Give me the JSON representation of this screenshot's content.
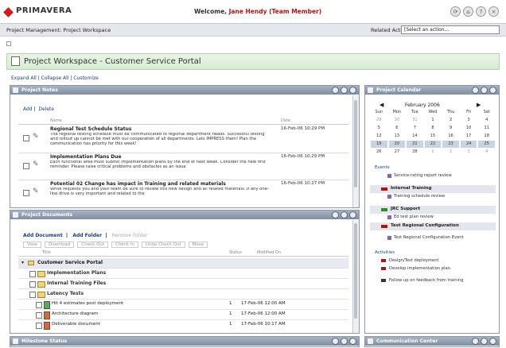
{
  "app": {
    "brand": "PRIMAVERA",
    "welcome_prefix": "Welcome,",
    "welcome_user": "Jane Hendy (Team Member)",
    "breadcrumb": "Project Management: Project Workspace",
    "related_actions_label": "Related Actions",
    "related_actions_value": "[Select an action..."
  },
  "page": {
    "title": "Project Workspace - Customer Service Portal",
    "expand_all": "Expand All",
    "collapse_all": "Collapse All",
    "customize": "Customize"
  },
  "project_notes": {
    "title": "Project Notes",
    "add": "Add",
    "delete": "Delete",
    "col_name": "Name",
    "col_date": "Date",
    "notes": [
      {
        "title": "Regional Test Schedule Status",
        "body": "The regional testing schedule must be communicated to regional department heads. Successful testing and rollout up cannot be met with our cooperation of all departments. Lets IMPRESS them! Plan the communication has priority for this week!",
        "date": "16-Feb-06 10:29 PM"
      },
      {
        "title": "Implementation Plans Due",
        "body": "Each functional area must submit implementation plans by the end of next week. Consider the new first reminder. Please raise critical problems and obstacles as an issue",
        "date": "16-Feb-06 10:29 PM"
      },
      {
        "title": "Potential 02 Change has impact in Training and related materials",
        "body": "While requests you and your team be sure to review this new design and all related materials. If any one-line drive is very important and related to the",
        "date": "16-Feb-06 10:27 PM"
      }
    ]
  },
  "project_documents": {
    "title": "Project Documents",
    "add_document": "Add Document",
    "add_folder": "Add Folder",
    "remove_folder": "Remove Folder",
    "toolbar": [
      "View",
      "Download",
      "Check Out",
      "Check In",
      "Undo Check Out",
      "Move"
    ],
    "col_title": "Title",
    "col_status": "Status",
    "col_modified": "Modified On",
    "root_folder": "Customer Service Portal",
    "folders": [
      "Implementation Plans",
      "Internal Training Files",
      "Latency Tests"
    ],
    "files": [
      {
        "name": "Hit 4 estimates post deployment",
        "status": "1",
        "modified": "17-Feb-06 12:00 AM"
      },
      {
        "name": "Architecture diagram",
        "status": "1",
        "modified": "17-Feb-06 12:00 AM"
      },
      {
        "name": "Deliverable document",
        "status": "1",
        "modified": "17-Feb-06 10:17 AM"
      }
    ]
  },
  "project_calendar": {
    "title": "Project Calendar",
    "month": "February 2006",
    "days": [
      "Sun",
      "Mon",
      "Tue",
      "Wed",
      "Thu",
      "Fri",
      "Sat"
    ],
    "weeks": [
      [
        "29",
        "30",
        "31",
        "1",
        "2",
        "3",
        "4"
      ],
      [
        "5",
        "6",
        "7",
        "8",
        "9",
        "10",
        "11"
      ],
      [
        "12",
        "13",
        "14",
        "15",
        "16",
        "17",
        "18"
      ],
      [
        "19",
        "20",
        "21",
        "22",
        "23",
        "24",
        "25"
      ],
      [
        "26",
        "27",
        "28",
        "1",
        "2",
        "3",
        "4"
      ]
    ],
    "events_label": "Events",
    "events": [
      {
        "group": "",
        "item": "Service-rating report review"
      },
      {
        "group": "Internal Training",
        "item": "Training schedule review"
      },
      {
        "group": "JRC Support",
        "item": "Ed test plan review"
      },
      {
        "group": "Test Regional Configuration",
        "item": "Test Regional Configuration Event"
      }
    ],
    "activities_label": "Activities",
    "activities": [
      "Design/Test deployment",
      "Develop implementation plan",
      "Follow up on feedback from training"
    ]
  },
  "bottom": {
    "milestone_status": "Milestone Status",
    "communication_center": "Communication Center"
  },
  "colors": {
    "brand_red": "#d21b1b",
    "portlet_header": "#8a98ab",
    "title_banner": "#dff0db"
  }
}
